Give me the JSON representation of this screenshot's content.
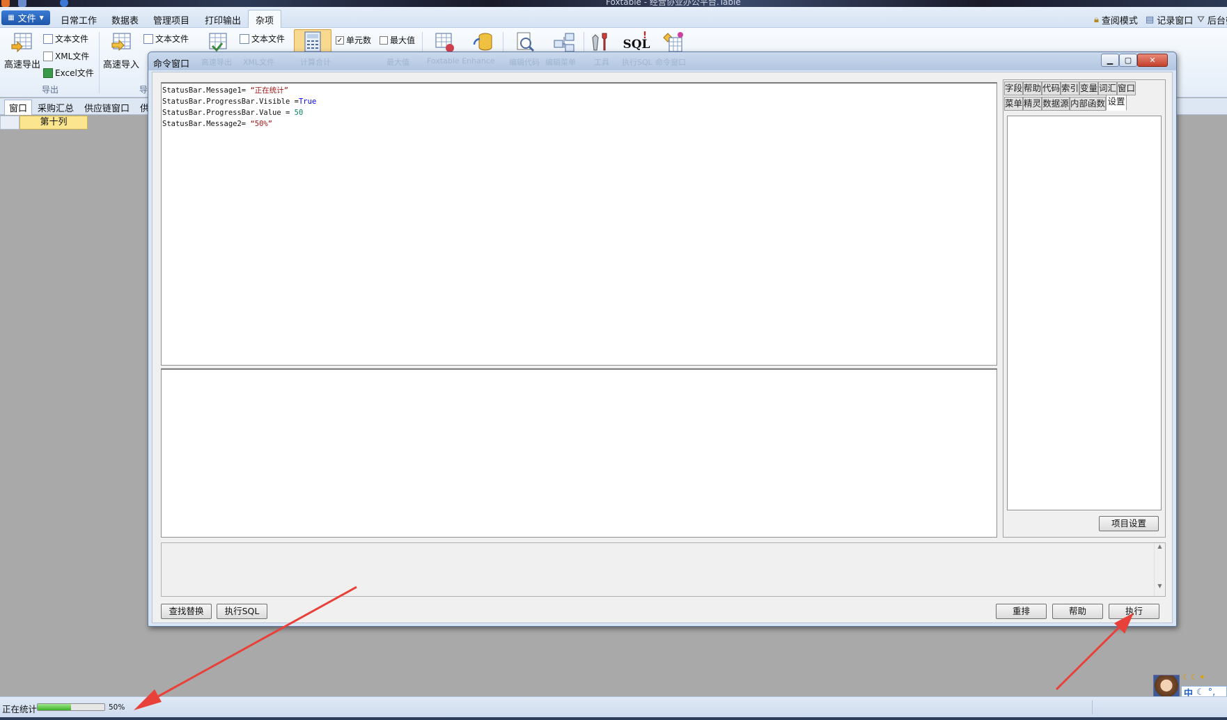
{
  "app": {
    "title": "Foxtable - 经营协业办公平台.Table"
  },
  "menu": {
    "file": "文件",
    "tabs": [
      "日常工作",
      "数据表",
      "管理项目",
      "打印输出",
      "杂项"
    ],
    "right": [
      "查阅模式",
      "记录窗口",
      "后台筛"
    ]
  },
  "ribbon": {
    "export_big": "高速导出",
    "export_items": [
      "文本文件",
      "XML文件",
      "Excel文件"
    ],
    "export_group": "导出",
    "import_big": "高速导入",
    "import_item": "文本文件",
    "import_group_partial": "导",
    "text_file_3": "文本文件",
    "checkbox_cell": "单元数",
    "checkbox_max": "最大值",
    "sql_label": "SQL"
  },
  "window_tabs": [
    "窗口",
    "采购汇总",
    "供应链窗口",
    "供"
  ],
  "grid": {
    "column_header": "第十列"
  },
  "command_window": {
    "title": "命令窗口",
    "ghost_ribbon": [
      "高速导出",
      "XML文件",
      "高速导入",
      "计算合计",
      "最大值",
      "Foxtable Enhance",
      "编辑代码",
      "编辑菜单",
      "工具",
      "执行SQL",
      "命令窗口"
    ],
    "code_lines": [
      {
        "obj": "StatusBar.Message1",
        "op": "= ",
        "val": "“正在统计”",
        "type": "str"
      },
      {
        "obj": "StatusBar.ProgressBar.Visible",
        "op": " =",
        "val": "True",
        "type": "kw"
      },
      {
        "obj": "StatusBar.ProgressBar.Value",
        "op": " = ",
        "val": "50",
        "type": "num"
      },
      {
        "obj": "StatusBar.Message2",
        "op": "= ",
        "val": "“50%”",
        "type": "str"
      }
    ],
    "side_tabs_row1": [
      "字段",
      "帮助",
      "代码",
      "索引",
      "变量",
      "词汇",
      "窗口"
    ],
    "side_tabs_row2": [
      "菜单",
      "精灵",
      "数据源",
      "内部函数",
      "设置"
    ],
    "active_side_tab": "设置",
    "project_settings_button": "项目设置",
    "find_replace_button": "查找替换",
    "exec_sql_button": "执行SQL",
    "rearrange_button": "重排",
    "help_button": "帮助",
    "execute_button": "执行"
  },
  "status_bar": {
    "message1": "正在统计",
    "progress_value": 50,
    "message2": "50%"
  },
  "ime": {
    "mode": "中"
  },
  "colors": {
    "string": "#a31515",
    "keyword": "#0000ff",
    "number": "#098658",
    "arrow": "#e8413a",
    "progress": "#3db12a"
  }
}
